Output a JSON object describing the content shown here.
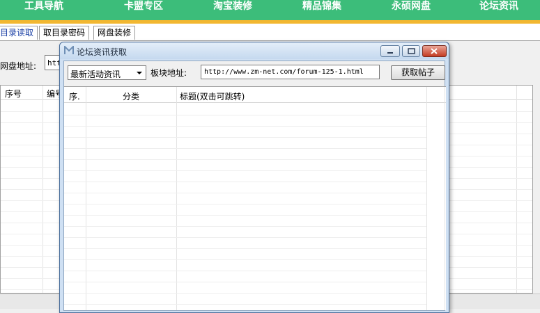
{
  "topnav": {
    "items": [
      "工具导航",
      "卡盟专区",
      "淘宝装修",
      "精品锦集",
      "永硕网盘",
      "论坛资讯"
    ]
  },
  "tabs": [
    "目录读取",
    "取目录密码",
    "网盘装修"
  ],
  "background": {
    "disk_label": "网盘地址:",
    "disk_input_value": "htt",
    "table_headers": [
      "序号",
      "编号"
    ]
  },
  "dialog": {
    "title": "论坛资讯获取",
    "category_select": "最新活动资讯",
    "address_label": "板块地址:",
    "address_value": "http://www.zm-net.com/forum-125-1.html",
    "fetch_button": "获取帖子",
    "columns": [
      "序.",
      "分类",
      "标题(双击可跳转)"
    ]
  },
  "colors": {
    "nav_green": "#3cbd7a",
    "nav_yellow": "#f2b731",
    "close_red": "#c43b23"
  }
}
